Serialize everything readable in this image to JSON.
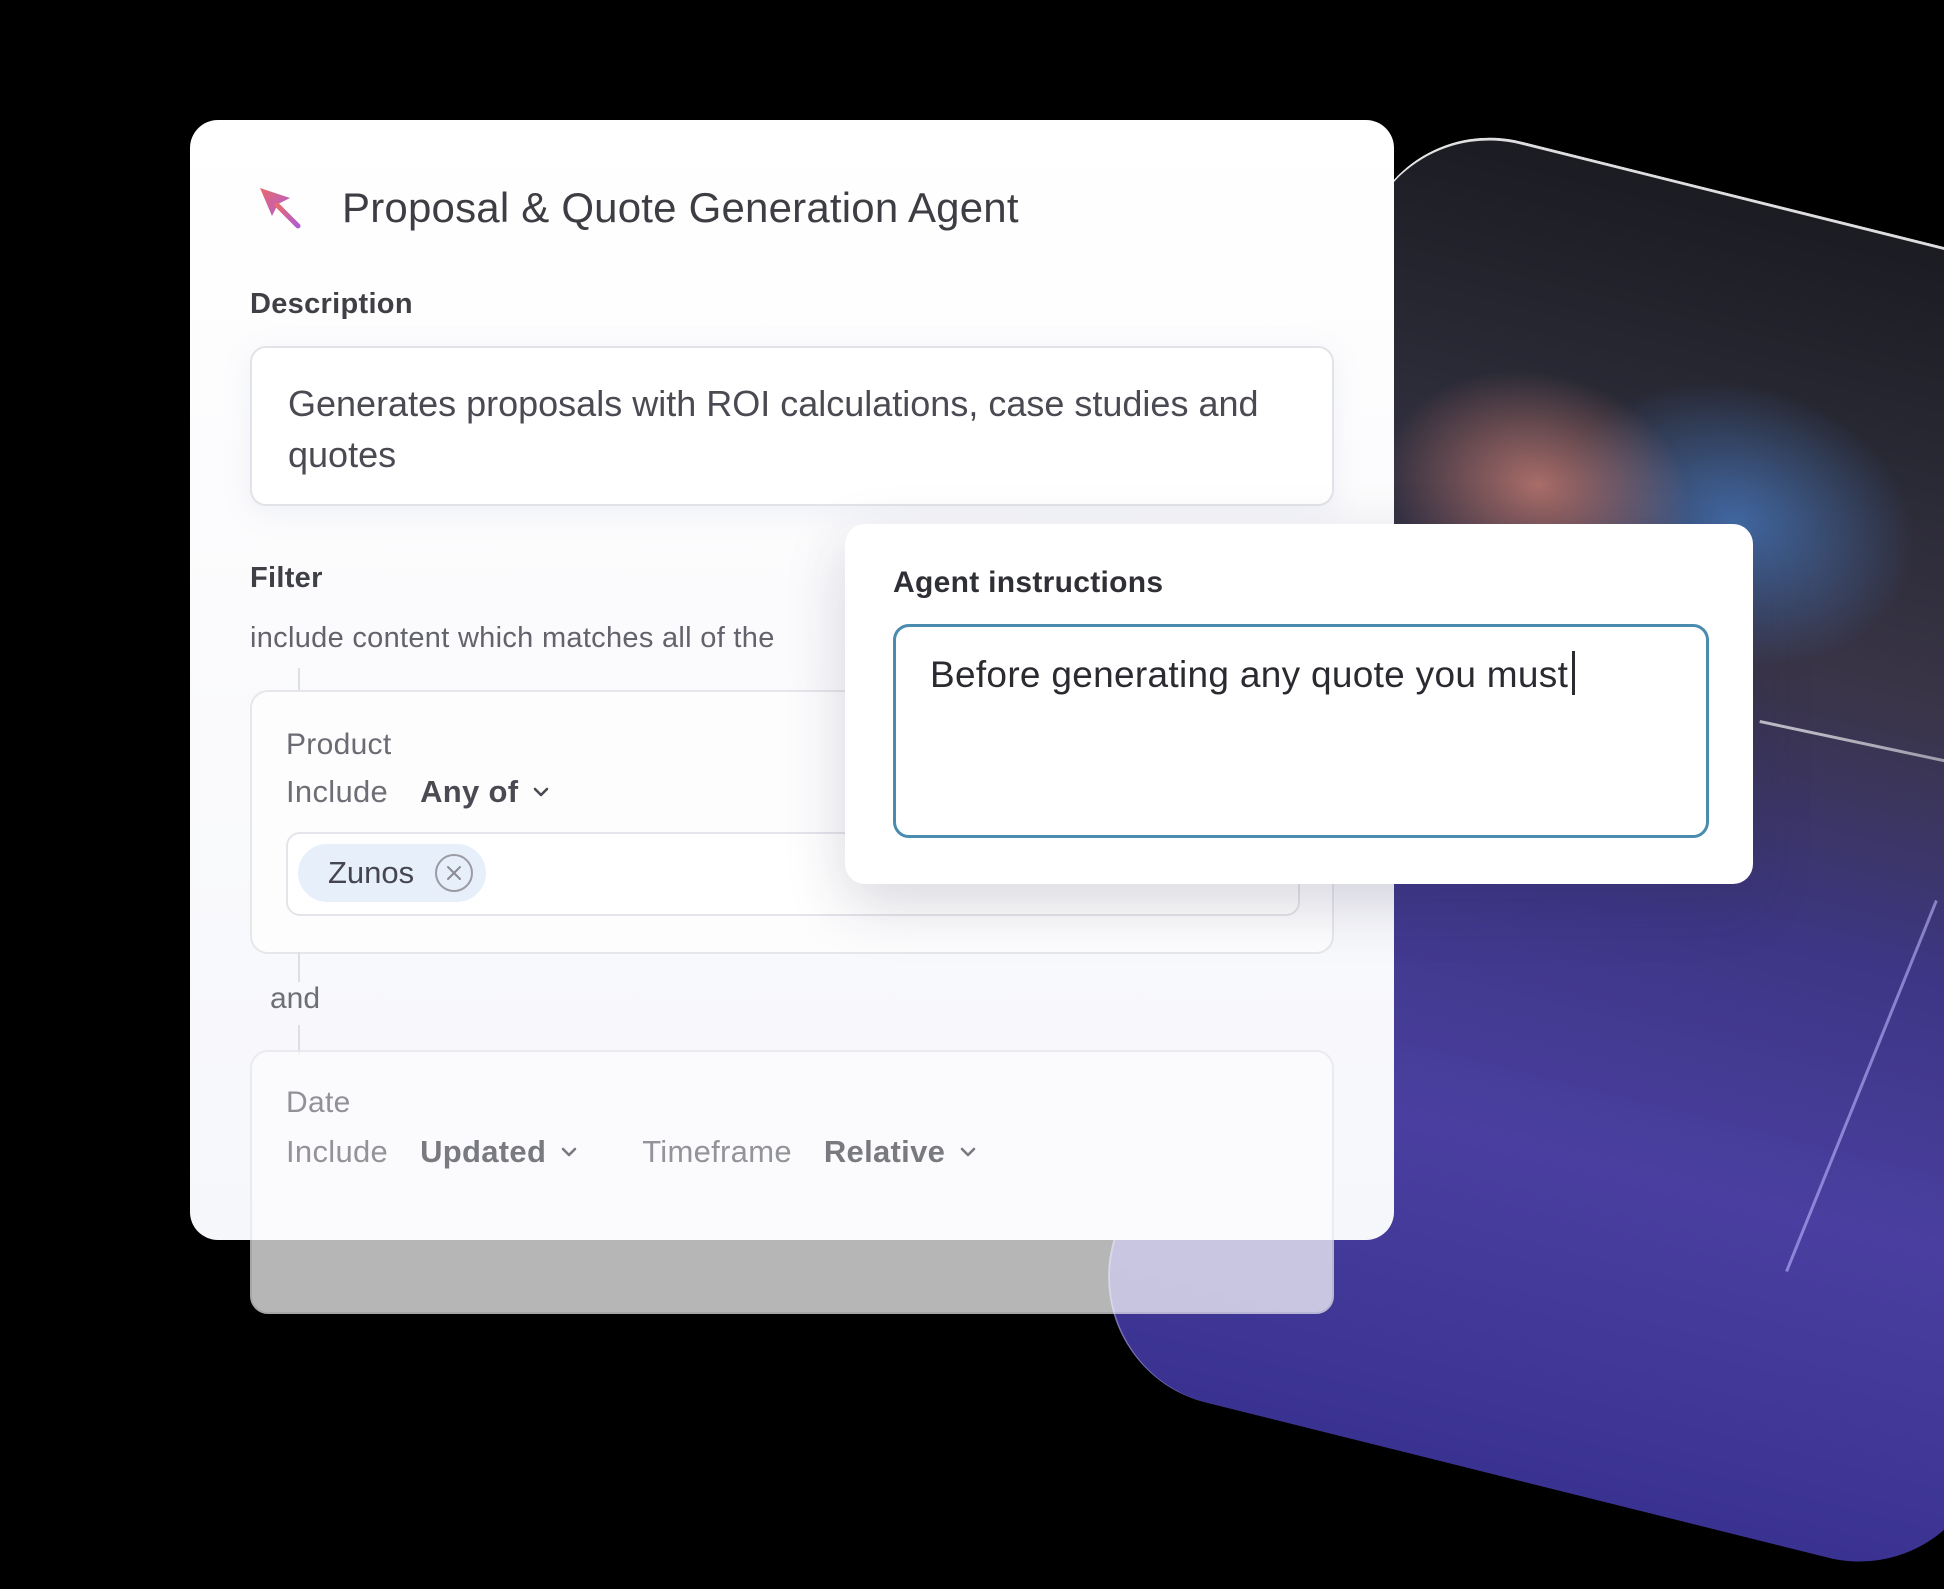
{
  "agent": {
    "title": "Proposal & Quote Generation Agent",
    "icon": "cursor-arrow-icon"
  },
  "description": {
    "label": "Description",
    "value": "Generates proposals with ROI calculations, case studies and quotes"
  },
  "filter": {
    "label": "Filter",
    "subtitle": "include content which matches all of the",
    "connector": "and",
    "groups": [
      {
        "title": "Product",
        "include_label": "Include",
        "include_value": "Any of",
        "tags": [
          "Zunos"
        ]
      },
      {
        "title": "Date",
        "include_label": "Include",
        "include_value": "Updated",
        "timeframe_label": "Timeframe",
        "timeframe_value": "Relative"
      }
    ]
  },
  "instructions": {
    "label": "Agent instructions",
    "value": "Before generating any quote you must"
  },
  "colors": {
    "focus_border": "#4a8bb0",
    "tag_bg": "#e7effb",
    "logo_gradient": [
      "#e2567a",
      "#b05bd6"
    ]
  }
}
